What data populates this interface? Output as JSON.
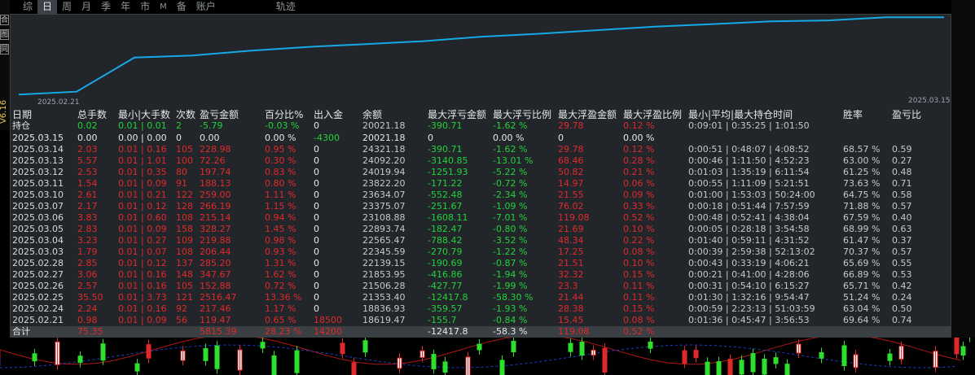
{
  "toolbar": {
    "tabs": [
      "综",
      "日",
      "周",
      "月",
      "季",
      "年",
      "市",
      "M",
      "备",
      "账户",
      "轨迹"
    ],
    "active_tab": "日"
  },
  "sidebar": {
    "icons": [
      "合",
      "图",
      "同"
    ],
    "version": "V6.16"
  },
  "equity": {
    "x_start_label": "2025.02.21",
    "x_end_label": "2025.03.15",
    "line_color": "#17a9e6",
    "points": [
      [
        "2025.02.21",
        18619.47
      ],
      [
        "2025.02.24",
        18836.93
      ],
      [
        "2025.02.25",
        21353.4
      ],
      [
        "2025.02.26",
        21506.28
      ],
      [
        "2025.02.27",
        21853.95
      ],
      [
        "2025.02.28",
        22139.15
      ],
      [
        "2025.03.03",
        22345.59
      ],
      [
        "2025.03.04",
        22565.47
      ],
      [
        "2025.03.05",
        22893.74
      ],
      [
        "2025.03.06",
        23108.88
      ],
      [
        "2025.03.07",
        23375.07
      ],
      [
        "2025.03.10",
        23634.07
      ],
      [
        "2025.03.11",
        23822.2
      ],
      [
        "2025.03.12",
        24019.94
      ],
      [
        "2025.03.13",
        24092.2
      ],
      [
        "2025.03.14",
        24321.18
      ]
    ]
  },
  "table": {
    "headers": [
      "日期",
      "总手数",
      "最小|大手数",
      "次数",
      "盈亏金额",
      "百分比%",
      "出入金",
      "余额",
      "最大浮亏金额",
      "最大浮亏比例",
      "最大浮盈金额",
      "最大浮盈比例",
      "最小|平均|最大持仓时间",
      "胜率",
      "盈亏比"
    ],
    "position_row": [
      "持仓",
      "0.02",
      "0.01 | 0.01",
      "2",
      "-5.79",
      "-0.03 %",
      "0",
      "20021.18",
      "-390.71",
      "-1.62 %",
      "29.78",
      "0.12 %",
      "0:09:01 | 0:35:25 | 1:01:50",
      "",
      ""
    ],
    "rows": [
      [
        "2025.03.15",
        "0.00",
        "0.00 | 0.00",
        "0",
        "0.00",
        "0.00 %",
        "-4300",
        "20021.18",
        "0",
        "0.00 %",
        "0",
        "0.00 %",
        "",
        "",
        ""
      ],
      [
        "2025.03.14",
        "2.03",
        "0.01 | 0.16",
        "105",
        "228.98",
        "0.95 %",
        "0",
        "24321.18",
        "-390.71",
        "-1.62 %",
        "29.78",
        "0.12 %",
        "0:00:51 | 0:48:07 | 4:08:52",
        "68.57 %",
        "0.59"
      ],
      [
        "2025.03.13",
        "5.57",
        "0.01 | 1.01",
        "100",
        "72.26",
        "0.30 %",
        "0",
        "24092.20",
        "-3140.85",
        "-13.01 %",
        "68.46",
        "0.28 %",
        "0:00:46 | 1:11:50 | 4:52:23",
        "63.00 %",
        "0.27"
      ],
      [
        "2025.03.12",
        "2.53",
        "0.01 | 0.35",
        "80",
        "197.74",
        "0.83 %",
        "0",
        "24019.94",
        "-1251.93",
        "-5.22 %",
        "50.82",
        "0.21 %",
        "0:01:03 | 1:35:19 | 6:11:54",
        "61.25 %",
        "0.48"
      ],
      [
        "2025.03.11",
        "1.54",
        "0.01 | 0.09",
        "91",
        "188.13",
        "0.80 %",
        "0",
        "23822.20",
        "-171.22",
        "-0.72 %",
        "14.97",
        "0.06 %",
        "0:00:55 | 1:11:09 | 5:21:51",
        "73.63 %",
        "0.71"
      ],
      [
        "2025.03.10",
        "2.61",
        "0.01 | 0.21",
        "122",
        "259.00",
        "1.11 %",
        "0",
        "23634.07",
        "-552.48",
        "-2.34 %",
        "21.55",
        "0.09 %",
        "0:01:00 | 1:53:03 | 50:24:00",
        "64.75 %",
        "0.58"
      ],
      [
        "2025.03.07",
        "2.17",
        "0.01 | 0.12",
        "128",
        "266.19",
        "1.15 %",
        "0",
        "23375.07",
        "-251.67",
        "-1.09 %",
        "76.02",
        "0.33 %",
        "0:00:18 | 0:51:44 | 7:57:59",
        "71.88 %",
        "0.57"
      ],
      [
        "2025.03.06",
        "3.83",
        "0.01 | 0.60",
        "108",
        "215.14",
        "0.94 %",
        "0",
        "23108.88",
        "-1608.11",
        "-7.01 %",
        "119.08",
        "0.52 %",
        "0:00:48 | 0:52:41 | 4:38:04",
        "67.59 %",
        "0.40"
      ],
      [
        "2025.03.05",
        "2.83",
        "0.01 | 0.09",
        "158",
        "328.27",
        "1.45 %",
        "0",
        "22893.74",
        "-182.47",
        "-0.80 %",
        "21.69",
        "0.10 %",
        "0:00:05 | 0:28:18 | 3:54:58",
        "68.99 %",
        "0.63"
      ],
      [
        "2025.03.04",
        "3.23",
        "0.01 | 0.27",
        "109",
        "219.88",
        "0.98 %",
        "0",
        "22565.47",
        "-788.42",
        "-3.52 %",
        "48.34",
        "0.22 %",
        "0:01:40 | 0:59:11 | 4:31:52",
        "61.47 %",
        "0.37"
      ],
      [
        "2025.03.03",
        "1.79",
        "0.01 | 0.07",
        "108",
        "206.44",
        "0.93 %",
        "0",
        "22345.59",
        "-270.79",
        "-1.22 %",
        "17.25",
        "0.08 %",
        "0:00:39 | 2:59:38 | 52:13:02",
        "70.37 %",
        "0.57"
      ],
      [
        "2025.02.28",
        "2.85",
        "0.01 | 0.12",
        "137",
        "285.20",
        "1.31 %",
        "0",
        "22139.15",
        "-190.69",
        "-0.87 %",
        "21.51",
        "0.10 %",
        "0:00:43 | 0:33:19 | 4:06:21",
        "65.69 %",
        "0.55"
      ],
      [
        "2025.02.27",
        "3.06",
        "0.01 | 0.16",
        "148",
        "347.67",
        "1.62 %",
        "0",
        "21853.95",
        "-416.86",
        "-1.94 %",
        "32.32",
        "0.15 %",
        "0:00:21 | 0:41:00 | 4:28:06",
        "66.89 %",
        "0.53"
      ],
      [
        "2025.02.26",
        "2.57",
        "0.01 | 0.16",
        "105",
        "152.88",
        "0.72 %",
        "0",
        "21506.28",
        "-427.77",
        "-1.99 %",
        "23.3",
        "0.11 %",
        "0:00:31 | 0:54:10 | 6:15:27",
        "65.71 %",
        "0.42"
      ],
      [
        "2025.02.25",
        "35.50",
        "0.01 | 3.73",
        "121",
        "2516.47",
        "13.36 %",
        "0",
        "21353.40",
        "-12417.8",
        "-58.30 %",
        "21.44",
        "0.11 %",
        "0:01:30 | 1:32:16 | 9:54:47",
        "51.24 %",
        "0.24"
      ],
      [
        "2025.02.24",
        "2.24",
        "0.01 | 0.16",
        "92",
        "217.46",
        "1.17 %",
        "0",
        "18836.93",
        "-359.57",
        "-1.93 %",
        "28.38",
        "0.15 %",
        "0:00:59 | 2:23:13 | 51:03:59",
        "63.04 %",
        "0.50"
      ],
      [
        "2025.02.21",
        "0.98",
        "0.01 | 0.09",
        "56",
        "119.47",
        "0.65 %",
        "18500",
        "18619.47",
        "-155.7",
        "-0.84 %",
        "15.45",
        "0.08 %",
        "0:01:36 | 0:45:47 | 3:56:53",
        "69.64 %",
        "0.74"
      ]
    ],
    "total_row": [
      "合计",
      "75.35",
      "",
      "",
      "5815.39",
      "28.23 %",
      "14200",
      "",
      "-12417.8",
      "-58.3 %",
      "119.08",
      "0.52 %",
      "",
      "",
      ""
    ]
  },
  "colors": {
    "profit": "#e02a2a",
    "loss": "#23d23a",
    "panel_bg": "#22262a",
    "equity_line": "#17a9e6"
  }
}
